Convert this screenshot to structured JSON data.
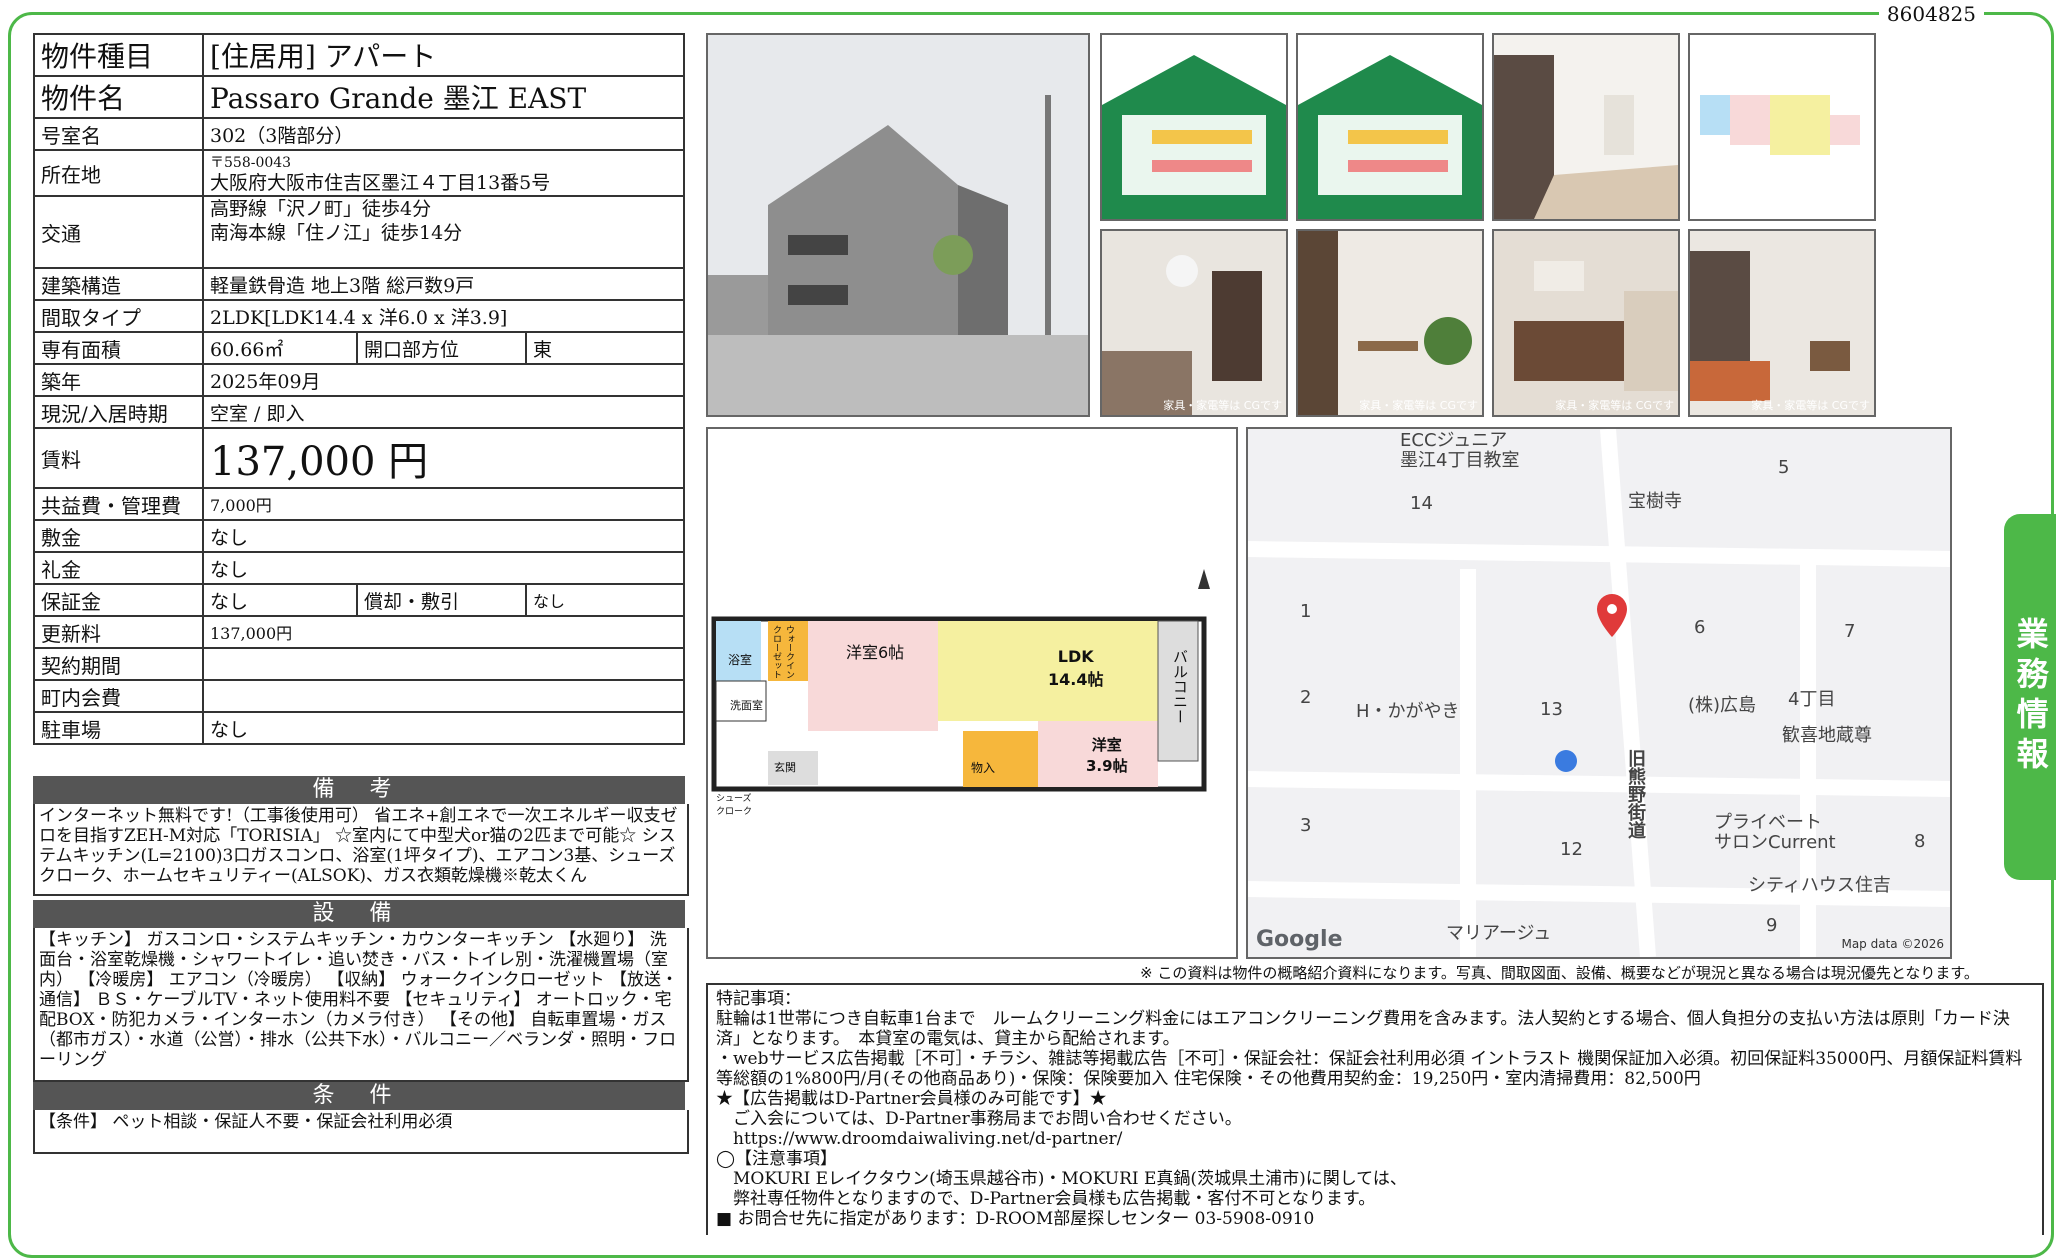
{
  "doc_id": "8604825",
  "side_tab": "業務情報",
  "fields": {
    "type_label": "物件種目",
    "type_value": "[住居用] アパート",
    "name_label": "物件名",
    "name_value": "Passaro Grande 墨江 EAST",
    "room_label": "号室名",
    "room_value": "302（3階部分）",
    "address_label": "所在地",
    "zip": "〒558-0043",
    "address": "大阪府大阪市住吉区墨江４丁目13番5号",
    "traffic_label": "交通",
    "traffic_1": "高野線「沢ノ町」徒歩4分",
    "traffic_2": "南海本線「住ノ江」徒歩14分",
    "structure_label": "建築構造",
    "structure_value": "軽量鉄骨造 地上3階 総戸数9戸",
    "layout_label": "間取タイプ",
    "layout_value": "2LDK[LDK14.4 x 洋6.0 x 洋3.9]",
    "area_label": "専有面積",
    "area_value": "60.66㎡",
    "direction_label": "開口部方位",
    "direction_value": "東",
    "built_label": "築年",
    "built_value": "2025年09月",
    "status_label": "現況/入居時期",
    "status_value": "空室 / 即入",
    "rent_label": "賃料",
    "rent_value": "137,000 円",
    "fee_label": "共益費・管理費",
    "fee_value": "7,000円",
    "deposit_label": "敷金",
    "deposit_value": "なし",
    "key_label": "礼金",
    "key_value": "なし",
    "guarantee_label": "保証金",
    "guarantee_value": "なし",
    "amort_label": "償却・敷引",
    "amort_value": "なし",
    "renewal_label": "更新料",
    "renewal_value": "137,000円",
    "contract_label": "契約期間",
    "contract_value": "",
    "town_label": "町内会費",
    "town_value": "",
    "parking_label": "駐車場",
    "parking_value": "なし"
  },
  "sections": {
    "remarks_head": "備 考",
    "remarks_body": "インターネット無料です!（工事後使用可） 省エネ+創エネで一次エネルギー収支ゼロを目指すZEH-M対応「TORISIA」 ☆室内にて中型犬or猫の2匹まで可能☆ システムキッチン(L=2100)3口ガスコンロ、浴室(1坪タイプ)、エアコン3基、シューズクローク、ホームセキュリティー(ALSOK)、ガス衣類乾燥機※乾太くん",
    "equip_head": "設 備",
    "equip_body": "【キッチン】 ガスコンロ・システムキッチン・カウンターキッチン 【水廻り】 洗面台・浴室乾燥機・シャワートイレ・追い焚き・バス・トイレ別・洗濯機置場（室内） 【冷暖房】 エアコン（冷暖房） 【収納】 ウォークインクローゼット 【放送・通信】 ＢＳ・ケーブルTV・ネット使用料不要 【セキュリティ】 オートロック・宅配BOX・防犯カメラ・インターホン（カメラ付き） 【その他】 自転車置場・ガス（都市ガス）・水道（公営）・排水（公共下水）・バルコニー／ベランダ・照明・フローリング",
    "cond_head": "条 件",
    "cond_body": "【条件】 ペット相談・保証人不要・保証会社利用必須"
  },
  "photo_caption": "家具・家電等は CGです",
  "floorplan": {
    "room_west": "洋室6帖",
    "ldk": "LDK\n14.4帖",
    "room_small": "洋室\n3.9帖",
    "bath": "浴室",
    "wash": "洗面室",
    "entrance": "玄関",
    "storage": "物入",
    "balcony": "バルコニー",
    "walkin": "ウォークインクローゼット",
    "shoes": "シューズクローク"
  },
  "map": {
    "labels": [
      "ECCジュニア\n墨江4丁目教室",
      "宝樹寺",
      "H・かがやき",
      "(株)広島",
      "4丁目",
      "歓喜地蔵尊",
      "プライベート\nサロンCurrent",
      "シティハウス住吉",
      "マリアージュ",
      "旧熊野街道"
    ],
    "numbers": [
      "14",
      "5",
      "1",
      "6",
      "7",
      "2",
      "13",
      "3",
      "12",
      "8",
      "9"
    ],
    "google": "Google",
    "attribution": "Map data ©2026"
  },
  "note_top": "※ この資料は物件の概略紹介資料になります。写真、間取図面、設備、概要などが現況と異なる場合は現況優先となります。",
  "remarks_lines": [
    "特記事項：",
    "駐輪は1世帯につき自転車1台まで　ルームクリーニング料金にはエアコンクリーニング費用を含みます。法人契約とする場合、個人負担分の支払い方法は原則「カード決済」となります。　本貸室の電気は、貸主から配給されます。",
    "・webサービス広告掲載［不可］・チラシ、雑誌等掲載広告［不可］・保証会社：保証会社利用必須 イントラスト 機関保証加入必須。初回保証料35000円、月額保証料賃料等総額の1%800円/月(その他商品あり)・保険：保険要加入 住宅保険・その他費用契約金：19,250円・室内清掃費用：82,500円",
    "★【広告掲載はD-Partner会員様のみ可能です】★",
    "　ご入会については、D-Partner事務局までお問い合わせください。",
    "　https://www.droomdaiwaliving.net/d-partner/",
    "◯【注意事項】",
    "　MOKURI Eレイクタウン(埼玉県越谷市)・MOKURI E真鍋(茨城県土浦市)に関しては、",
    "　弊社専任物件となりますので、D-Partner会員様も広告掲載・客付不可となります。",
    "■ お問合せ先に指定があります：D-ROOM部屋探しセンター 03-5908-0910"
  ]
}
